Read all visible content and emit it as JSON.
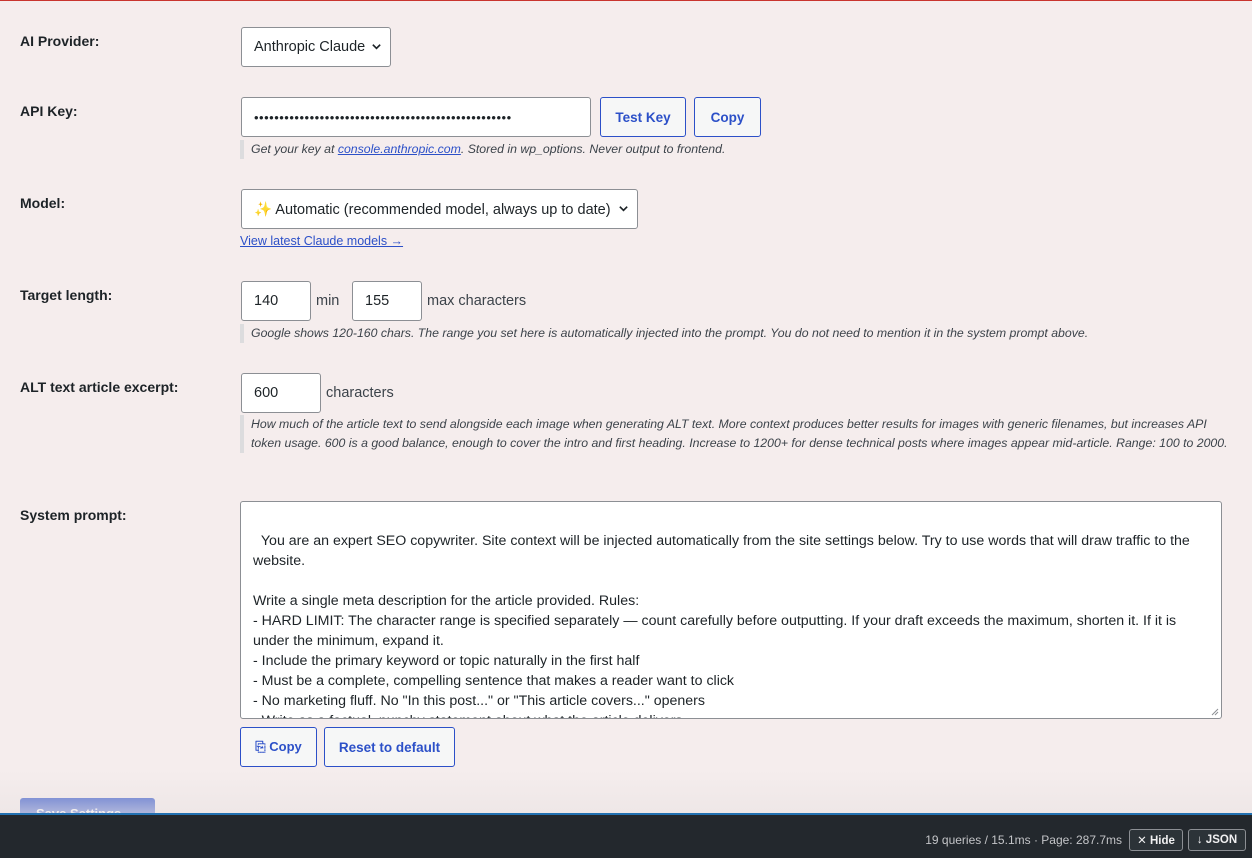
{
  "provider": {
    "label": "AI Provider:",
    "selected": "Anthropic Claude"
  },
  "api_key": {
    "label": "API Key:",
    "masked_value": "•••••••••••••••••••••••••••••••••••••••••••••••••••",
    "test_button": "Test Key",
    "copy_button": "Copy",
    "desc_prefix": "Get your key at ",
    "desc_link": "console.anthropic.com",
    "desc_suffix": ". Stored in wp_options. Never output to frontend."
  },
  "model": {
    "label": "Model:",
    "selected": "✨ Automatic (recommended model, always up to date)",
    "link": "View latest Claude models →"
  },
  "target_length": {
    "label": "Target length:",
    "min_value": "140",
    "min_unit": "min",
    "max_value": "155",
    "max_unit": "max characters",
    "desc": "Google shows 120-160 chars. The range you set here is automatically injected into the prompt. You do not need to mention it in the system prompt above."
  },
  "alt_excerpt": {
    "label": "ALT text article excerpt:",
    "value": "600",
    "unit": "characters",
    "desc": "How much of the article text to send alongside each image when generating ALT text. More context produces better results for images with generic filenames, but increases API token usage. 600 is a good balance, enough to cover the intro and first heading. Increase to 1200+ for dense technical posts where images appear mid-article. Range: 100 to 2000."
  },
  "system_prompt": {
    "label": "System prompt:",
    "text": "You are an expert SEO copywriter. Site context will be injected automatically from the site settings below. Try to use words that will draw traffic to the website.\n\nWrite a single meta description for the article provided. Rules:\n- HARD LIMIT: The character range is specified separately — count carefully before outputting. If your draft exceeds the maximum, shorten it. If it is under the minimum, expand it.\n- Include the primary keyword or topic naturally in the first half\n- Must be a complete, compelling sentence that makes a reader want to click\n- No marketing fluff. No \"In this post...\" or \"This article covers...\" openers\n- Write as a factual, punchy statement about what the article delivers\n- Output ONLY the meta description text — no quotes, no labels, nothing else",
    "copy_button": "⎘ Copy",
    "reset_button": "Reset to default"
  },
  "save": {
    "label": "Save Settings"
  },
  "query_monitor": {
    "stats": "19 queries / 15.1ms · Page: 287.7ms",
    "hide_button": "✕ Hide",
    "json_button": "↓ JSON"
  },
  "colors": {
    "background": "#f5eded",
    "accent": "#2c50c8",
    "bar": "#23282d"
  }
}
